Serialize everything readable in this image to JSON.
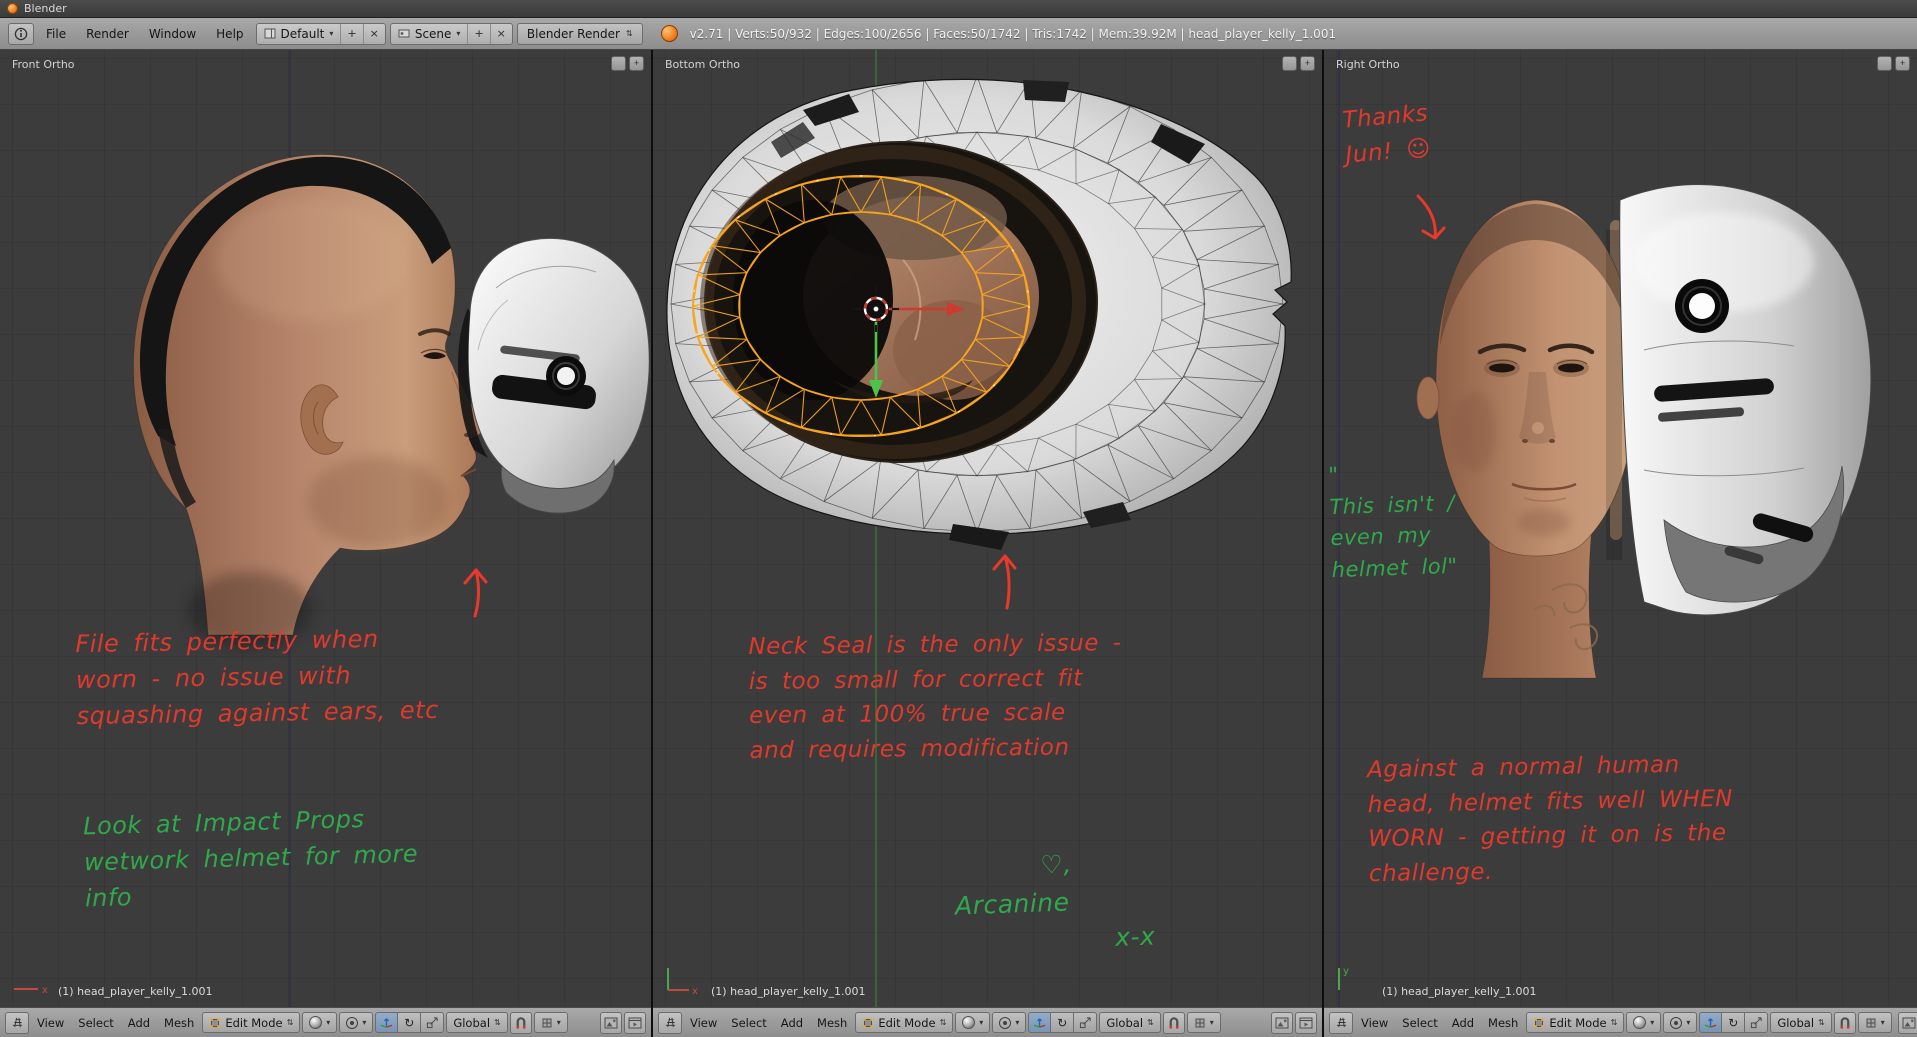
{
  "window": {
    "title": "Blender"
  },
  "header": {
    "menus": [
      "File",
      "Render",
      "Window",
      "Help"
    ],
    "layout": "Default",
    "scene": "Scene",
    "engine": "Blender Render",
    "stats": "v2.71 | Verts:50/932 | Edges:100/2656 | Faces:50/1742 | Tris:1742 | Mem:39.92M | head_player_kelly_1.001"
  },
  "footer": {
    "menus": [
      "View",
      "Select",
      "Add",
      "Mesh"
    ],
    "mode": "Edit Mode",
    "orientation": "Global"
  },
  "viewports": [
    {
      "label": "Front Ortho",
      "object": "(1) head_player_kelly_1.001",
      "red_note": "File fits perfectly when\nworn - no issue with\nsquashing against ears, etc",
      "green_note": "Look at Impact Props\nwetwork helmet for more\ninfo"
    },
    {
      "label": "Bottom Ortho",
      "object": "(1) head_player_kelly_1.001",
      "red_note": "Neck Seal is the only issue -\nis too small for correct fit\neven at 100% true scale\nand requires modification",
      "green_note": "      ♡,\nArcanine\n           x-x"
    },
    {
      "label": "Right Ortho",
      "object": "(1) head_player_kelly_1.001",
      "red_note_top": "Thanks\nJun! ☺",
      "green_note": "\"\nThis isn't /\neven my\nhelmet lol\"",
      "red_note": "Against a normal human\nhead, helmet fits well WHEN\nWORN - getting it on is the\nchallenge."
    }
  ],
  "icons": {
    "add": "+",
    "close": "×",
    "caret": "▾",
    "updown": "⇅",
    "rotate": "↻",
    "plus_small": "+"
  },
  "colors": {
    "annotation_red": "#e8392b",
    "annotation_green": "#2fae4d",
    "select_orange": "#f7a51f"
  }
}
